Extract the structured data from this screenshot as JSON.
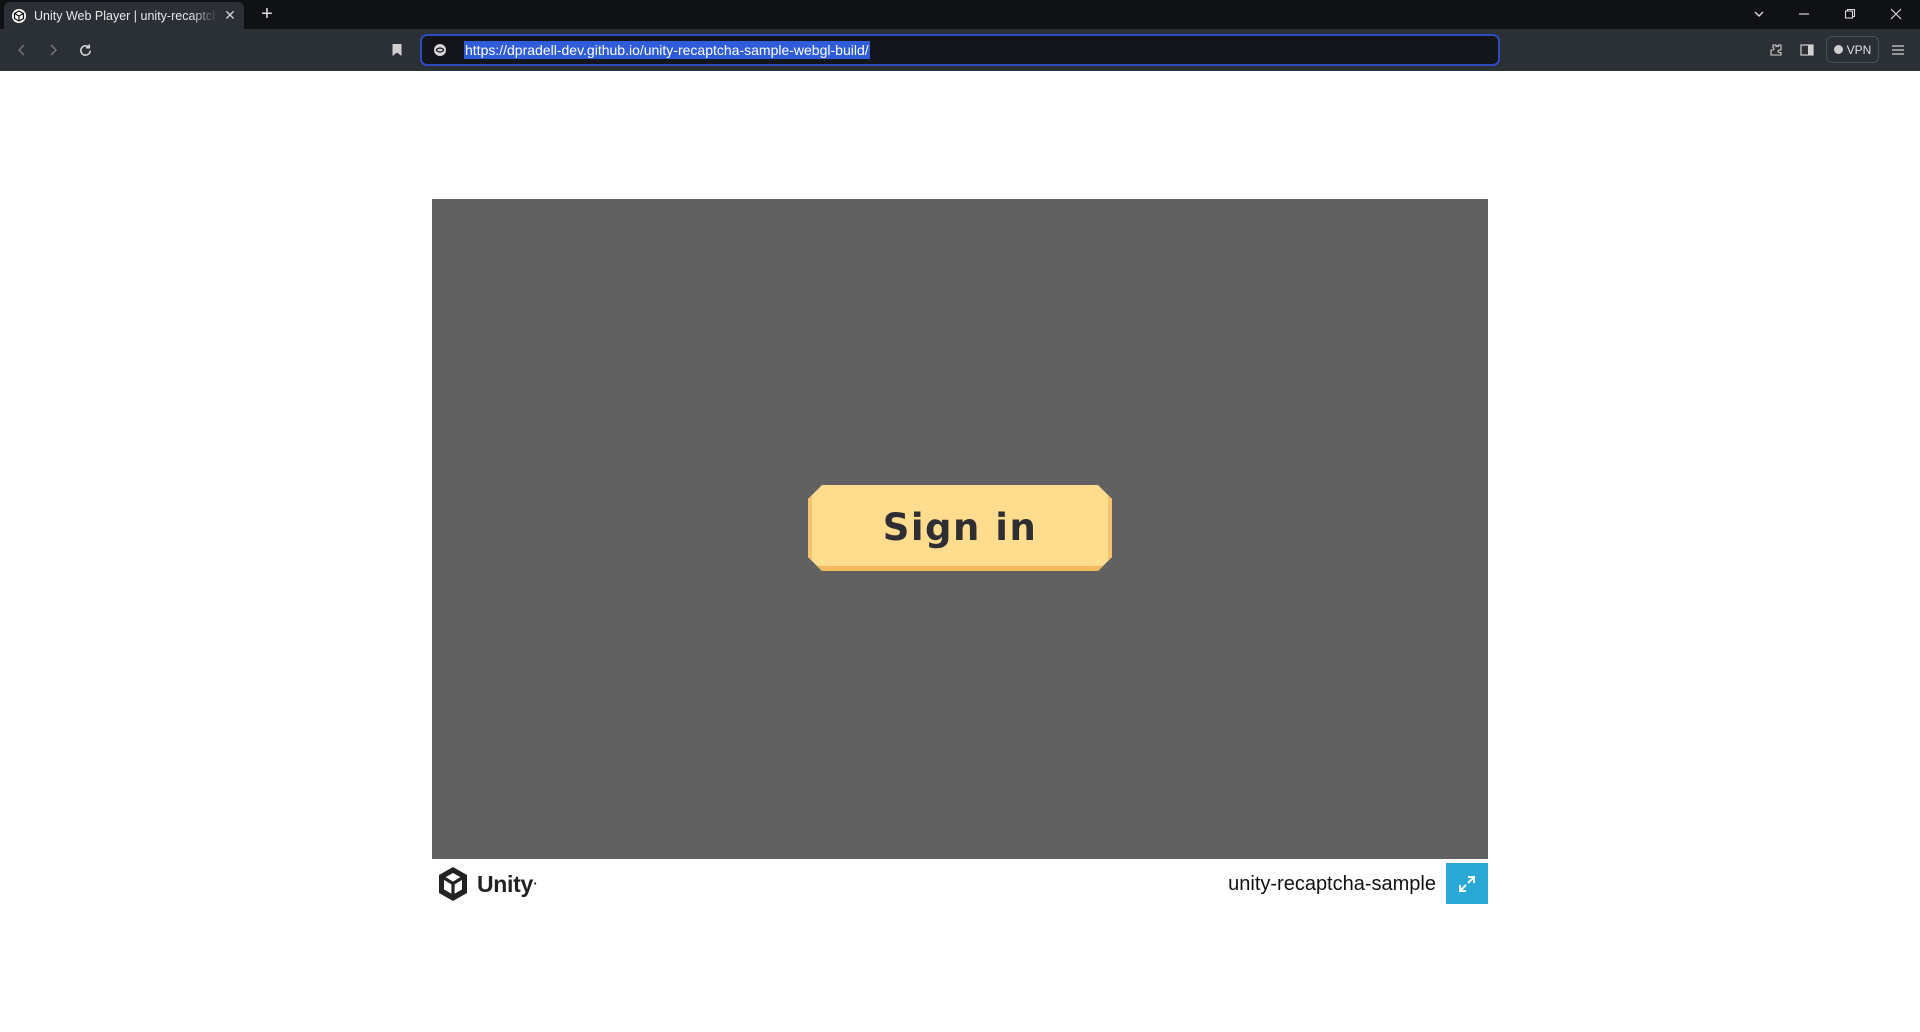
{
  "browser": {
    "tab": {
      "title": "Unity Web Player | unity-recaptcha-sample",
      "favicon": "unity-icon"
    },
    "address_bar": {
      "url": "https://dpradell-dev.github.io/unity-recaptcha-sample-webgl-build/"
    },
    "vpn_label": "VPN",
    "icons": [
      "back-icon",
      "forward-icon",
      "reload-icon",
      "bookmark-icon",
      "site-info-icon",
      "extensions-icon",
      "sidebar-icon",
      "menu-icon",
      "tab-list-icon",
      "minimize-icon",
      "restore-icon",
      "close-window-icon"
    ]
  },
  "game": {
    "signin_label": "Sign in",
    "canvas_color": "#616161",
    "button_color": "#ffdc8e"
  },
  "footer": {
    "logo_text": "Unity",
    "build_title": "unity-recaptcha-sample",
    "fullscreen_icon": "fullscreen-icon",
    "accent": "#2aa8d6"
  }
}
